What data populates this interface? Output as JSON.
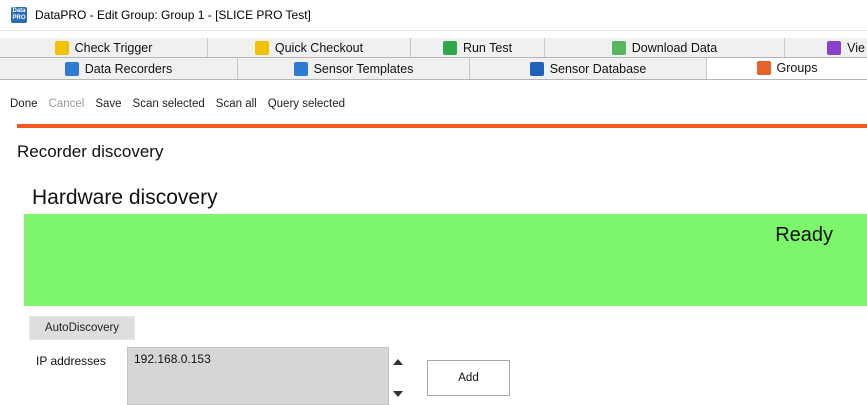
{
  "window": {
    "title": "DataPRO - Edit Group: Group 1  - [SLICE PRO Test]",
    "icon_label": "Data PRO"
  },
  "tabs_row1": [
    {
      "label": "Check Trigger",
      "icon": "trigger-icon"
    },
    {
      "label": "Quick Checkout",
      "icon": "checkout-icon"
    },
    {
      "label": "Run Test",
      "icon": "run-test-icon"
    },
    {
      "label": "Download Data",
      "icon": "download-icon"
    },
    {
      "label": "Vie",
      "icon": "view-icon"
    }
  ],
  "tabs_row2": [
    {
      "label": "Data Recorders",
      "icon": "recorder-icon"
    },
    {
      "label": "Sensor Templates",
      "icon": "template-icon"
    },
    {
      "label": "Sensor Database",
      "icon": "database-icon"
    },
    {
      "label": "Groups",
      "icon": "groups-icon",
      "active": true
    }
  ],
  "toolbar": {
    "done": "Done",
    "cancel": "Cancel",
    "save": "Save",
    "scan_selected": "Scan selected",
    "scan_all": "Scan all",
    "query_selected": "Query selected"
  },
  "colors": {
    "accent": "#f05a1e",
    "status_ready": "#7df56c"
  },
  "main": {
    "section_title": "Recorder discovery",
    "hardware_title": "Hardware discovery",
    "status": "Ready",
    "autodiscovery_label": "AutoDiscovery",
    "ip_label": "IP addresses",
    "ip_value": "192.168.0.153",
    "add_label": "Add"
  }
}
